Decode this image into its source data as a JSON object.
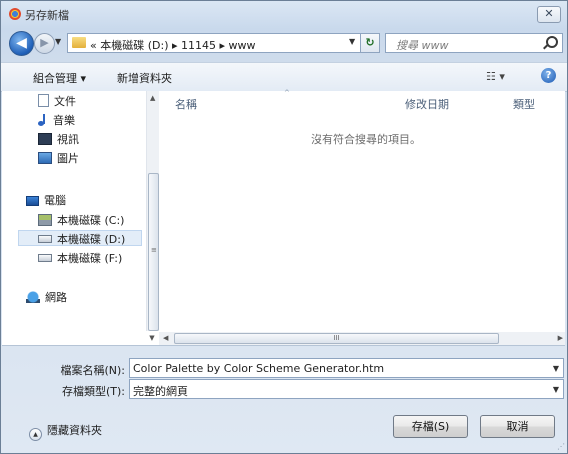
{
  "window": {
    "title": "另存新檔",
    "close_label": "✕"
  },
  "nav": {
    "back_glyph": "◀",
    "forward_glyph": "▶",
    "recent_glyph": "▼",
    "address_text": "« 本機磁碟 (D:) ▸ 11145 ▸ www",
    "address_drop_glyph": "▼",
    "refresh_glyph": "↻",
    "search_placeholder": "搜尋 www"
  },
  "toolbar": {
    "organize_label": "組合管理 ▾",
    "new_folder_label": "新增資料夾",
    "view_label": "☷ ▾",
    "help_label": "?"
  },
  "sidebar": {
    "items": [
      {
        "label": "文件",
        "icon": "document-icon"
      },
      {
        "label": "音樂",
        "icon": "music-icon"
      },
      {
        "label": "視訊",
        "icon": "video-icon"
      },
      {
        "label": "圖片",
        "icon": "picture-icon"
      },
      {
        "label": "電腦",
        "icon": "computer-icon"
      },
      {
        "label": "本機磁碟 (C:)",
        "icon": "drive-c-icon"
      },
      {
        "label": "本機磁碟 (D:)",
        "icon": "drive-icon",
        "selected": true
      },
      {
        "label": "本機磁碟 (F:)",
        "icon": "drive-icon"
      },
      {
        "label": "網路",
        "icon": "network-icon"
      }
    ]
  },
  "file_list": {
    "columns": [
      "名稱",
      "修改日期",
      "類型"
    ],
    "sort_glyph": "^",
    "empty_message": "沒有符合搜尋的項目。"
  },
  "scroll": {
    "up": "▲",
    "down": "▼",
    "left": "◀",
    "right": "▶",
    "grip_h": "III",
    "grip_v": "≡"
  },
  "form": {
    "filename_label": "檔案名稱(N):",
    "filename_value": "Color Palette by Color Scheme Generator.htm",
    "filetype_label": "存檔類型(T):",
    "filetype_value": "完整的網頁",
    "drop_glyph": "▼"
  },
  "footer": {
    "hide_folders_label": "隱藏資料夾",
    "hide_glyph": "▲",
    "save_label": "存檔(S)",
    "cancel_label": "取消"
  }
}
